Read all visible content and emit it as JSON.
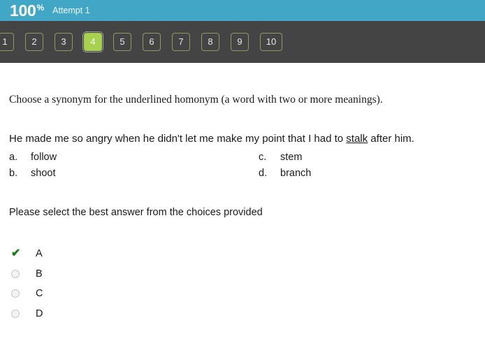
{
  "header": {
    "score": "100",
    "percent_symbol": "%",
    "attempt": "Attempt 1",
    "background_color": "#42a7c6"
  },
  "question_nav": {
    "active_index": 3,
    "active_color": "#a7d14f",
    "background_color": "#444444",
    "buttons": [
      {
        "label": "1",
        "active": false
      },
      {
        "label": "2",
        "active": false
      },
      {
        "label": "3",
        "active": false
      },
      {
        "label": "4",
        "active": true
      },
      {
        "label": "5",
        "active": false
      },
      {
        "label": "6",
        "active": false
      },
      {
        "label": "7",
        "active": false
      },
      {
        "label": "8",
        "active": false
      },
      {
        "label": "9",
        "active": false
      },
      {
        "label": "10",
        "active": false
      }
    ]
  },
  "question": {
    "instruction": "Choose a synonym for the underlined homonym (a word with two or more meanings).",
    "stem_before": "He made me so angry when he didn't let me make my point that I had to ",
    "stem_underlined": "stalk",
    "stem_after": " after him.",
    "choices": [
      {
        "letter": "a.",
        "text": "follow",
        "column": "left",
        "row": 1
      },
      {
        "letter": "b.",
        "text": "shoot",
        "column": "left",
        "row": 2
      },
      {
        "letter": "c.",
        "text": "stem",
        "column": "right",
        "row": 1
      },
      {
        "letter": "d.",
        "text": "branch",
        "column": "right",
        "row": 2
      }
    ],
    "select_prompt": "Please select the best answer from the choices provided"
  },
  "answer_options": {
    "correct_color": "#1d7a1d",
    "items": [
      {
        "label": "A",
        "marker": "check-icon",
        "selected": true
      },
      {
        "label": "B",
        "marker": "radio-empty",
        "selected": false
      },
      {
        "label": "C",
        "marker": "radio-empty",
        "selected": false
      },
      {
        "label": "D",
        "marker": "radio-empty",
        "selected": false
      }
    ]
  }
}
